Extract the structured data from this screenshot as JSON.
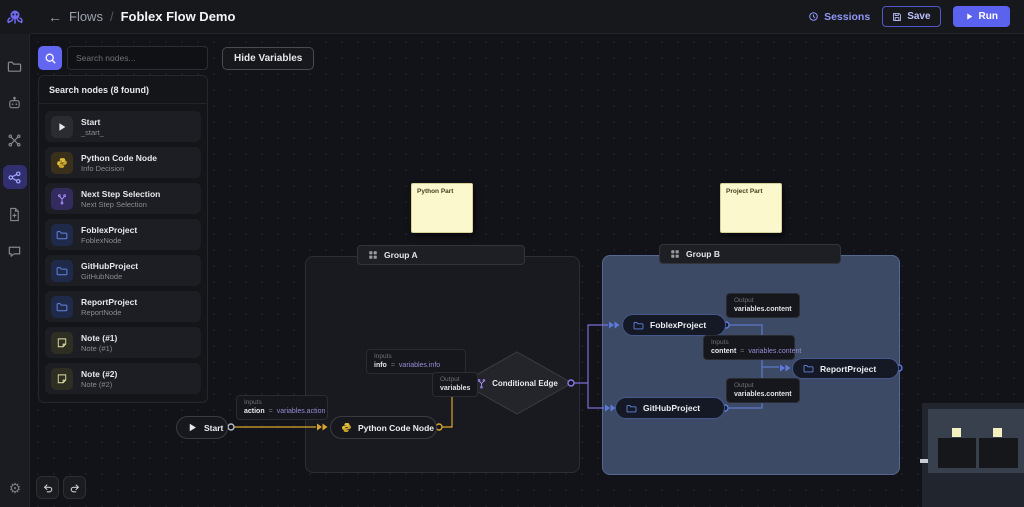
{
  "topbar": {
    "back": "←",
    "breadcrumb_section": "Flows",
    "breadcrumb_sep": "/",
    "title": "Foblex Flow Demo",
    "sessions_label": "Sessions",
    "save_label": "Save",
    "run_label": "Run"
  },
  "toolbar": {
    "hide_variables_label": "Hide Variables",
    "search_placeholder": "Search nodes..."
  },
  "palette": {
    "header": "Search nodes (8 found)",
    "items": [
      {
        "title": "Start",
        "subtitle": "_start_",
        "icon": "play-icon"
      },
      {
        "title": "Python Code Node",
        "subtitle": "Info Decision",
        "icon": "python-icon"
      },
      {
        "title": "Next Step Selection",
        "subtitle": "Next Step Selection",
        "icon": "branch-icon"
      },
      {
        "title": "FoblexProject",
        "subtitle": "FoblexNode",
        "icon": "folder-icon"
      },
      {
        "title": "GitHubProject",
        "subtitle": "GitHubNode",
        "icon": "folder-icon"
      },
      {
        "title": "ReportProject",
        "subtitle": "ReportNode",
        "icon": "folder-icon"
      },
      {
        "title": "Note (#1)",
        "subtitle": "Note (#1)",
        "icon": "note-icon"
      },
      {
        "title": "Note (#2)",
        "subtitle": "Note (#2)",
        "icon": "note-icon"
      }
    ]
  },
  "canvas": {
    "groups": [
      {
        "label": "Group A"
      },
      {
        "label": "Group B"
      }
    ],
    "notes": [
      {
        "text": "Python Part"
      },
      {
        "text": "Project Part"
      }
    ],
    "nodes": {
      "start": "Start",
      "python": "Python Code Node",
      "conditional": "Conditional Edge",
      "foblex": "FoblexProject",
      "github": "GitHubProject",
      "report": "ReportProject"
    },
    "chips": [
      {
        "label": "Inputs",
        "name": "action",
        "op": "=",
        "value": "variables.action"
      },
      {
        "label": "Inputs",
        "name": "info",
        "op": "=",
        "value": "variables.info"
      },
      {
        "label": "Output",
        "value": "variables"
      },
      {
        "label": "Output",
        "value": "variables.content"
      },
      {
        "label": "Inputs",
        "name": "content",
        "op": "=",
        "value": "variables.content"
      },
      {
        "label": "Output",
        "value": "variables.content"
      }
    ]
  },
  "colors": {
    "accent": "#5b63ee",
    "edge_yellow": "#d9a62e",
    "edge_purple": "#7c6bd6",
    "edge_blue": "#5b79c9",
    "note_bg": "#fbf8cd",
    "group_b_bg": "#3d4a66"
  }
}
